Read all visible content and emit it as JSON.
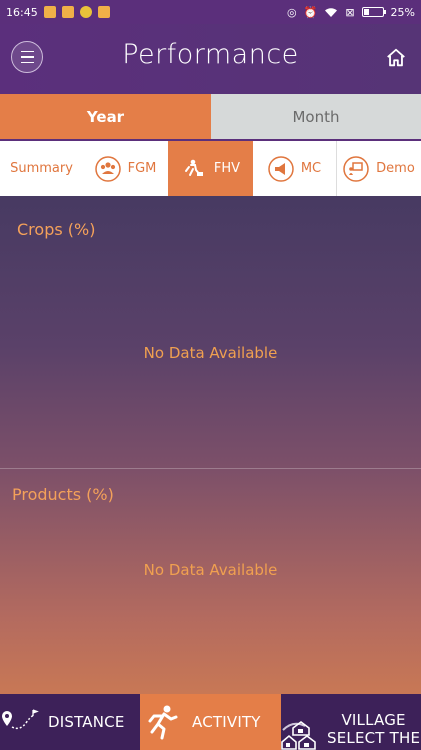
{
  "status_bar": {
    "time": "16:45",
    "battery": "25%"
  },
  "app_bar": {
    "title": "Performance"
  },
  "period_tabs": [
    {
      "label": "Year",
      "active": true
    },
    {
      "label": "Month",
      "active": false
    }
  ],
  "filter_tabs": [
    {
      "label": "Summary",
      "icon": null,
      "active": false
    },
    {
      "label": "FGM",
      "icon": "group-icon",
      "active": false
    },
    {
      "label": "FHV",
      "icon": "farmer-visit-icon",
      "active": true
    },
    {
      "label": "MC",
      "icon": "megaphone-icon",
      "active": false
    },
    {
      "label": "Demo",
      "icon": "presentation-icon",
      "active": false
    }
  ],
  "sections": {
    "crops": {
      "title": "Crops (%)",
      "empty_message": "No Data Available"
    },
    "products": {
      "title": "Products (%)",
      "empty_message": "No Data Available"
    }
  },
  "bottom_nav": {
    "distance": {
      "label": "DISTANCE",
      "icon": "map-pin-route-icon"
    },
    "activity": {
      "label": "ACTIVITY",
      "icon": "running-icon"
    },
    "village": {
      "label_line1": "VILLAGE",
      "label_line2": "SELECT THE",
      "icon": "village-houses-icon"
    }
  },
  "colors": {
    "primary_purple": "#5b2f7b",
    "accent_orange": "#e47e48",
    "inactive_grey": "#d6d9d9",
    "section_text": "#f4a15a"
  }
}
